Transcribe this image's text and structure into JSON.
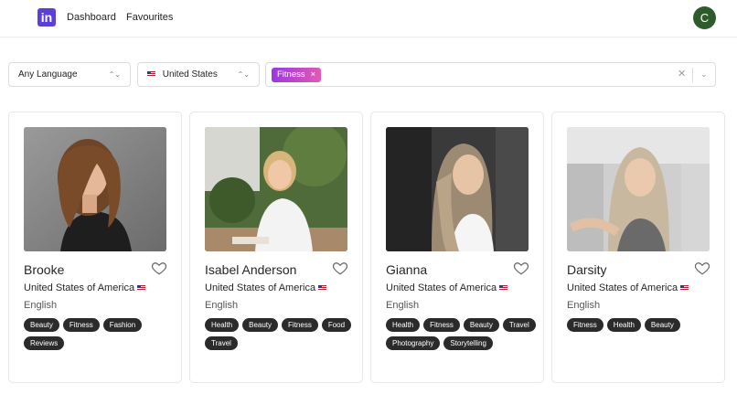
{
  "nav": {
    "logo_text": "in",
    "links": [
      "Dashboard",
      "Favourites"
    ],
    "avatar_initial": "C",
    "accent": "#5b3fd6"
  },
  "filters": {
    "language": "Any Language",
    "country": "United States",
    "selected_tags": [
      "Fitness"
    ]
  },
  "influencers": [
    {
      "name": "Brooke",
      "country": "United States of America",
      "language": "English",
      "tags": [
        "Beauty",
        "Fitness",
        "Fashion",
        "Reviews"
      ]
    },
    {
      "name": "Isabel Anderson",
      "country": "United States of America",
      "language": "English",
      "tags": [
        "Health",
        "Beauty",
        "Fitness",
        "Food",
        "Travel"
      ]
    },
    {
      "name": "Gianna",
      "country": "United States of America",
      "language": "English",
      "tags": [
        "Health",
        "Fitness",
        "Beauty",
        "Travel",
        "Photography",
        "Storytelling"
      ]
    },
    {
      "name": "Darsity",
      "country": "United States of America",
      "language": "English",
      "tags": [
        "Fitness",
        "Health",
        "Beauty"
      ]
    }
  ]
}
